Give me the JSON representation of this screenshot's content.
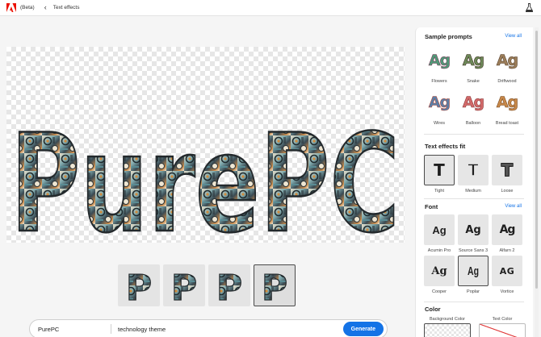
{
  "topbar": {
    "beta": "(Beta)",
    "back": "‹",
    "title": "Text effects"
  },
  "canvas": {
    "text": "PurePC"
  },
  "thumbnails": [
    {
      "letter": "P"
    },
    {
      "letter": "P"
    },
    {
      "letter": "P"
    },
    {
      "letter": "P",
      "selected": true
    }
  ],
  "prompt": {
    "text": "PurePC",
    "theme": "technology theme",
    "generate": "Generate"
  },
  "panel": {
    "sample_prompts": {
      "title": "Sample prompts",
      "view_all": "View all",
      "items": [
        {
          "label": "Flowers",
          "text": "Ag",
          "color": "#4f9a78"
        },
        {
          "label": "Snake",
          "text": "Ag",
          "color": "#6e8a5a"
        },
        {
          "label": "Driftwood",
          "text": "Ag",
          "color": "#9c7e5a"
        },
        {
          "label": "Wires",
          "text": "Ag",
          "color": "#5a7fa8"
        },
        {
          "label": "Balloon",
          "text": "Ag",
          "color": "#d36a6a"
        },
        {
          "label": "Bread toast",
          "text": "Ag",
          "color": "#c8894a"
        }
      ]
    },
    "fit": {
      "title": "Text effects fit",
      "items": [
        {
          "label": "Tight",
          "glyph": "T",
          "selected": true
        },
        {
          "label": "Medium",
          "glyph": "T"
        },
        {
          "label": "Loose",
          "glyph": "T"
        }
      ]
    },
    "font": {
      "title": "Font",
      "view_all": "View all",
      "items": [
        {
          "label": "Acumin Pro",
          "text": "Ag"
        },
        {
          "label": "Source Sans 3",
          "text": "Ag"
        },
        {
          "label": "Alfarn 2",
          "text": "Ag"
        },
        {
          "label": "Cooper",
          "text": "Ag"
        },
        {
          "label": "Poplar",
          "text": "Ag",
          "selected": true
        },
        {
          "label": "Vortice",
          "text": "AG"
        }
      ]
    },
    "color": {
      "title": "Color",
      "background_label": "Background Color",
      "text_label": "Text Color"
    }
  }
}
